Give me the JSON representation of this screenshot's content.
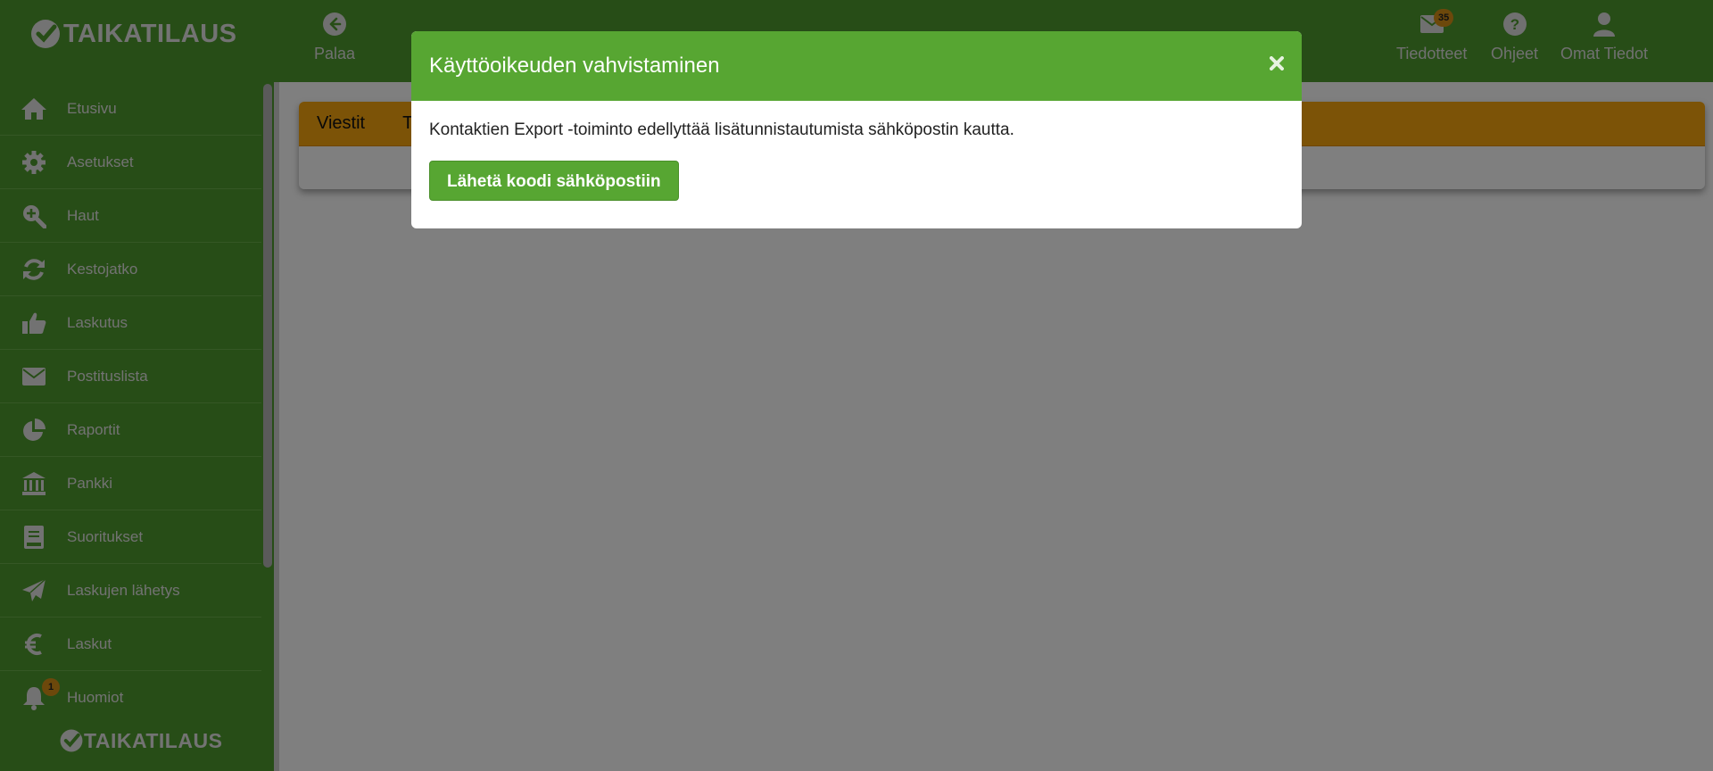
{
  "brand": {
    "name": "TAIKATILAUS"
  },
  "topnav": {
    "back": {
      "label": "Palaa",
      "icon": "arrow-left-circle-icon"
    },
    "notices": {
      "label": "Tiedotteet",
      "badge": "35",
      "icon": "envelope-icon"
    },
    "help": {
      "label": "Ohjeet",
      "icon": "question-circle-icon"
    },
    "profile": {
      "label": "Omat Tiedot",
      "icon": "user-icon"
    }
  },
  "sidebar": {
    "items": [
      {
        "label": "Etusivu",
        "icon": "home-icon"
      },
      {
        "label": "Asetukset",
        "icon": "gear-icon"
      },
      {
        "label": "Haut",
        "icon": "search-plus-icon"
      },
      {
        "label": "Kestojatko",
        "icon": "refresh-icon"
      },
      {
        "label": "Laskutus",
        "icon": "thumbs-up-icon"
      },
      {
        "label": "Postituslista",
        "icon": "envelope-icon"
      },
      {
        "label": "Raportit",
        "icon": "pie-chart-icon"
      },
      {
        "label": "Pankki",
        "icon": "bank-icon"
      },
      {
        "label": "Suoritukset",
        "icon": "book-icon"
      },
      {
        "label": "Laskujen lähetys",
        "icon": "paper-plane-icon"
      },
      {
        "label": "Laskut",
        "icon": "euro-icon"
      },
      {
        "label": "Huomiot",
        "icon": "bell-icon",
        "badge": "1"
      }
    ]
  },
  "main": {
    "tabs": [
      {
        "label": "Viestit"
      },
      {
        "label": "Ta"
      }
    ]
  },
  "modal": {
    "title": "Käyttöoikeuden vahvistaminen",
    "message": "Kontaktien Export -toiminto edellyttää lisätunnistautumista sähköpostin kautta.",
    "button": "Lähetä koodi sähköpostiin",
    "close_icon": "close-icon"
  },
  "colors": {
    "brand_green": "#57a632",
    "tab_orange": "#f9a70f",
    "badge_orange": "#d99116"
  }
}
